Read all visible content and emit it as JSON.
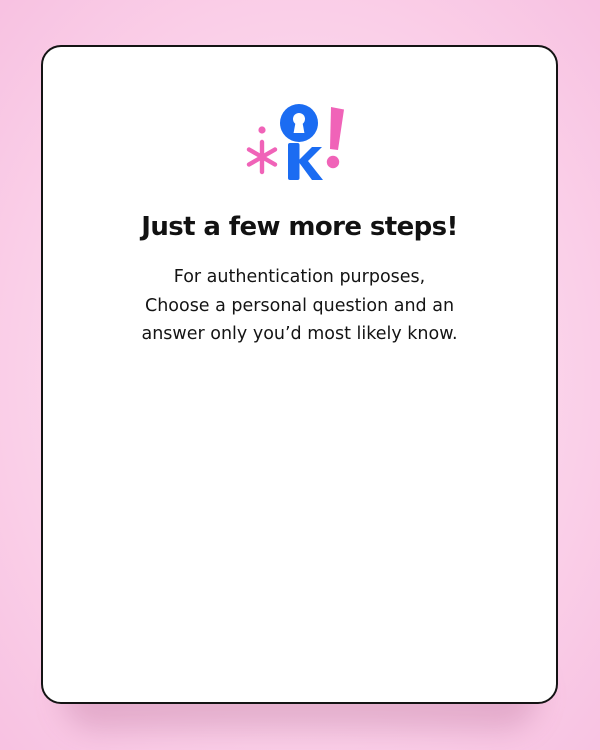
{
  "logo": {
    "icon": "ok-keyhole-logo",
    "colors": {
      "pink": "#f063b8",
      "blue": "#1b6cf2"
    }
  },
  "heading": "Just a few more steps!",
  "description": [
    "For authentication purposes,",
    "Choose a personal question and an",
    "answer only you’d most likely know."
  ],
  "theme": {
    "background": "#fbd3ea",
    "card": "#ffffff",
    "border": "#141414",
    "text": "#121212"
  }
}
